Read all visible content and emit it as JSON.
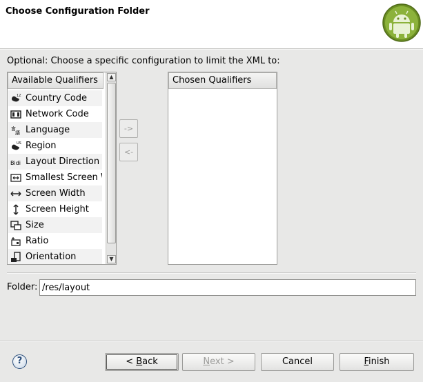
{
  "header": {
    "title": "Choose Configuration Folder"
  },
  "prompt": "Optional: Choose a specific configuration to limit the XML to:",
  "available": {
    "header": "Available Qualifiers",
    "items": [
      {
        "label": "Country Code",
        "icon": "country-code-icon"
      },
      {
        "label": "Network Code",
        "icon": "network-code-icon"
      },
      {
        "label": "Language",
        "icon": "language-icon"
      },
      {
        "label": "Region",
        "icon": "region-icon"
      },
      {
        "label": "Layout Direction",
        "icon": "layout-direction-icon"
      },
      {
        "label": "Smallest Screen Width",
        "icon": "smallest-screen-width-icon"
      },
      {
        "label": "Screen Width",
        "icon": "screen-width-icon"
      },
      {
        "label": "Screen Height",
        "icon": "screen-height-icon"
      },
      {
        "label": "Size",
        "icon": "size-icon"
      },
      {
        "label": "Ratio",
        "icon": "ratio-icon"
      },
      {
        "label": "Orientation",
        "icon": "orientation-icon"
      }
    ]
  },
  "arrows": {
    "add": "->",
    "remove": "<-"
  },
  "chosen": {
    "header": "Chosen Qualifiers"
  },
  "folder": {
    "label": "Folder:",
    "value": "/res/layout"
  },
  "buttons": {
    "help": "?",
    "back_underline": "B",
    "back_rest": "ack",
    "back_prefix": "< ",
    "next_underline": "N",
    "next_rest": "ext >",
    "cancel": "Cancel",
    "finish_underline": "F",
    "finish_rest": "inish"
  }
}
